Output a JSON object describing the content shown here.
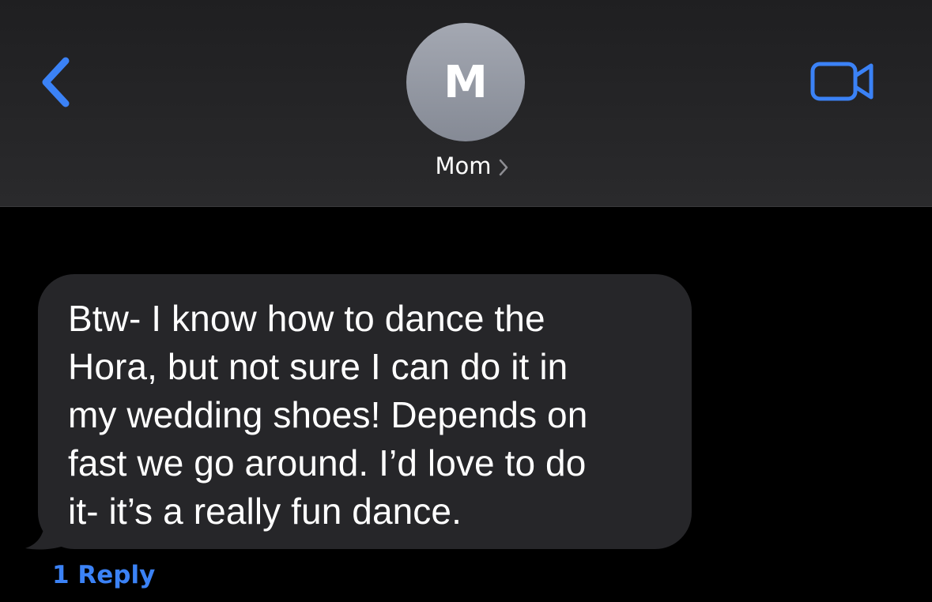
{
  "header": {
    "back_icon": "chevron-left-icon",
    "contact": {
      "initial": "M",
      "name": "Mom",
      "chevron_icon": "chevron-right-icon"
    },
    "video_icon": "video-camera-icon",
    "accent_color": "#3b82f6"
  },
  "conversation": {
    "messages": [
      {
        "direction": "incoming",
        "text": "Btw- I know how to dance the\nHora, but not sure I can do it in\nmy wedding shoes!  Depends on\nfast we go around. I’d love to do\nit- it’s a really fun dance."
      }
    ],
    "reply_label": "1 Reply"
  }
}
